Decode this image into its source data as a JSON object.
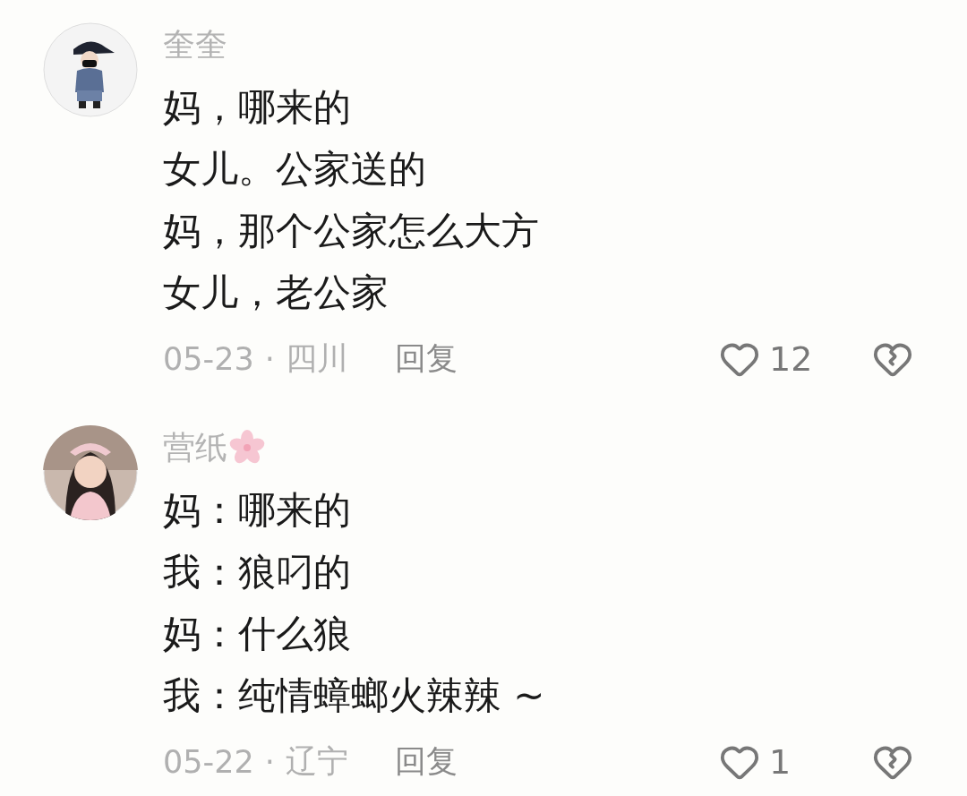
{
  "comments": [
    {
      "name": "奎奎",
      "flower_badge": false,
      "lines": [
        "妈，哪来的",
        "女儿。公家送的",
        "妈，那个公家怎么大方",
        "女儿，老公家"
      ],
      "date": "05-23",
      "separator": "·",
      "location": "四川",
      "reply": "回复",
      "likes": "12"
    },
    {
      "name": "营纸",
      "flower_badge": true,
      "lines": [
        "妈：哪来的",
        "我：狼叼的",
        "妈：什么狼",
        "我：纯情蟑螂火辣辣 ~"
      ],
      "date": "05-22",
      "separator": "·",
      "location": "辽宁",
      "reply": "回复",
      "likes": "1"
    }
  ]
}
